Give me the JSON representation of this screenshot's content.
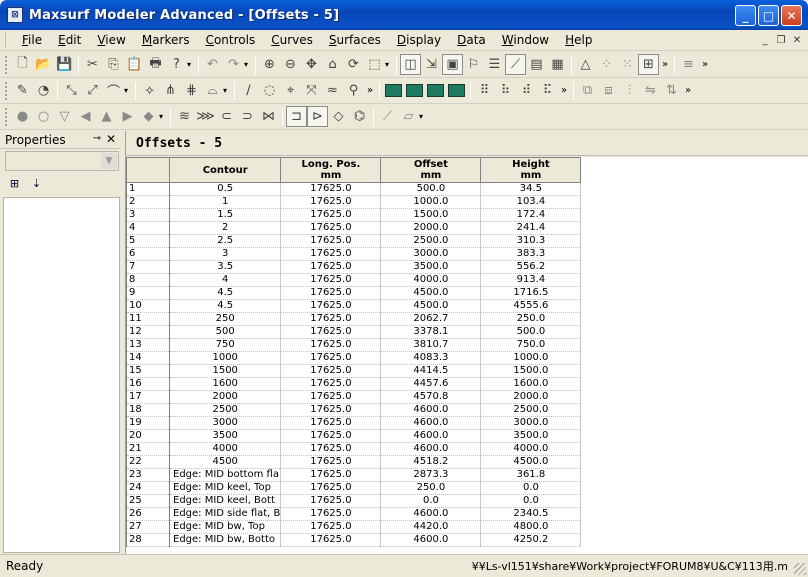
{
  "window": {
    "title": "Maxsurf Modeler Advanced - [Offsets - 5]",
    "app_icon": "hull-icon",
    "controls": {
      "minimize": "_",
      "maximize": "□",
      "close": "✕"
    }
  },
  "menubar": {
    "items": [
      {
        "mnemonic": "F",
        "rest": "ile"
      },
      {
        "mnemonic": "E",
        "rest": "dit"
      },
      {
        "mnemonic": "V",
        "rest": "iew"
      },
      {
        "mnemonic": "M",
        "rest": "arkers"
      },
      {
        "mnemonic": "C",
        "rest": "ontrols"
      },
      {
        "mnemonic": "C",
        "rest": "urves"
      },
      {
        "mnemonic": "S",
        "rest": "urfaces"
      },
      {
        "mnemonic": "D",
        "rest": "isplay"
      },
      {
        "mnemonic": "D",
        "rest": "ata"
      },
      {
        "mnemonic": "W",
        "rest": "indow"
      },
      {
        "mnemonic": "H",
        "rest": "elp"
      }
    ],
    "mdi_controls": {
      "minimize": "_",
      "restore": "❐",
      "close": "✕"
    }
  },
  "properties": {
    "title": "Properties",
    "pin": "📌",
    "close": "✕"
  },
  "document": {
    "title": "Offsets - 5",
    "columns": [
      {
        "top": "Contour",
        "bottom": ""
      },
      {
        "top": "Long. Pos.",
        "bottom": "mm"
      },
      {
        "top": "Offset",
        "bottom": "mm"
      },
      {
        "top": "Height",
        "bottom": "mm"
      }
    ],
    "rows": [
      [
        "1",
        "0.5",
        "17625.0",
        "500.0",
        "34.5"
      ],
      [
        "2",
        "1",
        "17625.0",
        "1000.0",
        "103.4"
      ],
      [
        "3",
        "1.5",
        "17625.0",
        "1500.0",
        "172.4"
      ],
      [
        "4",
        "2",
        "17625.0",
        "2000.0",
        "241.4"
      ],
      [
        "5",
        "2.5",
        "17625.0",
        "2500.0",
        "310.3"
      ],
      [
        "6",
        "3",
        "17625.0",
        "3000.0",
        "383.3"
      ],
      [
        "7",
        "3.5",
        "17625.0",
        "3500.0",
        "556.2"
      ],
      [
        "8",
        "4",
        "17625.0",
        "4000.0",
        "913.4"
      ],
      [
        "9",
        "4.5",
        "17625.0",
        "4500.0",
        "1716.5"
      ],
      [
        "10",
        "4.5",
        "17625.0",
        "4500.0",
        "4555.6"
      ],
      [
        "11",
        "250",
        "17625.0",
        "2062.7",
        "250.0"
      ],
      [
        "12",
        "500",
        "17625.0",
        "3378.1",
        "500.0"
      ],
      [
        "13",
        "750",
        "17625.0",
        "3810.7",
        "750.0"
      ],
      [
        "14",
        "1000",
        "17625.0",
        "4083.3",
        "1000.0"
      ],
      [
        "15",
        "1500",
        "17625.0",
        "4414.5",
        "1500.0"
      ],
      [
        "16",
        "1600",
        "17625.0",
        "4457.6",
        "1600.0"
      ],
      [
        "17",
        "2000",
        "17625.0",
        "4570.8",
        "2000.0"
      ],
      [
        "18",
        "2500",
        "17625.0",
        "4600.0",
        "2500.0"
      ],
      [
        "19",
        "3000",
        "17625.0",
        "4600.0",
        "3000.0"
      ],
      [
        "20",
        "3500",
        "17625.0",
        "4600.0",
        "3500.0"
      ],
      [
        "21",
        "4000",
        "17625.0",
        "4600.0",
        "4000.0"
      ],
      [
        "22",
        "4500",
        "17625.0",
        "4518.2",
        "4500.0"
      ],
      [
        "23",
        "Edge: MID bottom fla",
        "17625.0",
        "2873.3",
        "361.8"
      ],
      [
        "24",
        "Edge: MID keel, Top",
        "17625.0",
        "250.0",
        "0.0"
      ],
      [
        "25",
        "Edge: MID keel, Bott",
        "17625.0",
        "0.0",
        "0.0"
      ],
      [
        "26",
        "Edge: MID side flat, B",
        "17625.0",
        "4600.0",
        "2340.5"
      ],
      [
        "27",
        "Edge: MID bw, Top",
        "17625.0",
        "4420.0",
        "4800.0"
      ],
      [
        "28",
        "Edge: MID bw, Botto",
        "17625.0",
        "4600.0",
        "4250.2"
      ]
    ]
  },
  "statusbar": {
    "left": "Ready",
    "right": "¥¥Ls-vl151¥share¥Work¥project¥FORUM8¥U&C¥113用.m"
  }
}
